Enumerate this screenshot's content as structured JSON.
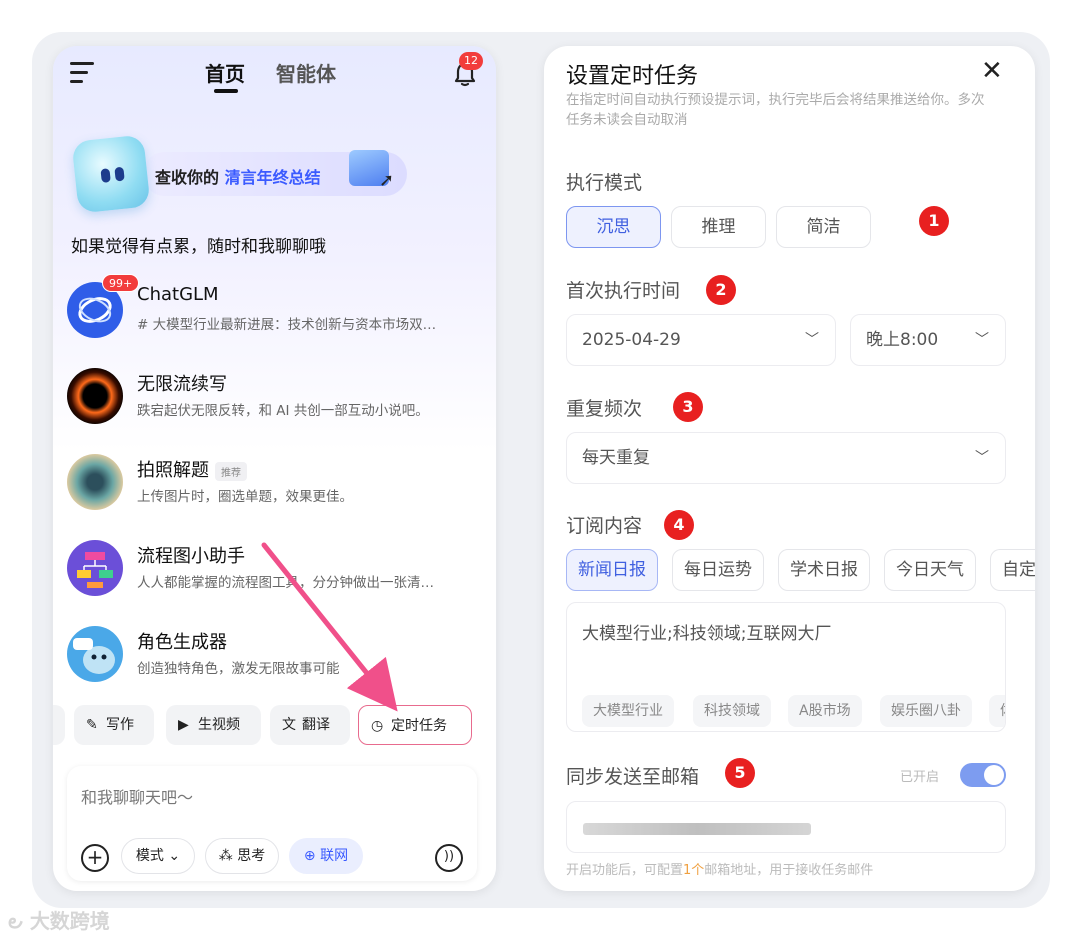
{
  "left_phone": {
    "tabs": [
      "首页",
      "智能体"
    ],
    "notification_count": "12",
    "banner": {
      "prefix": "查收你的 ",
      "highlight": "清言年终总结"
    },
    "greeting": "如果觉得有点累，随时和我聊聊哦",
    "agents": [
      {
        "name": "ChatGLM",
        "desc": "# 大模型行业最新进展：技术创新与资本市场双…",
        "badge": "99+"
      },
      {
        "name": "无限流续写",
        "desc": "跌宕起伏无限反转，和 AI 共创一部互动小说吧。"
      },
      {
        "name": "拍照解题",
        "desc": "上传图片时，圈选单题，效果更佳。",
        "tag": "推荐"
      },
      {
        "name": "流程图小助手",
        "desc": "人人都能掌握的流程图工具，分分钟做出一张清…"
      },
      {
        "name": "角色生成器",
        "desc": "创造独特角色，激发无限故事可能"
      }
    ],
    "quick_actions": [
      "写作",
      "生视频",
      "翻译",
      "定时任务"
    ],
    "input": {
      "placeholder": "和我聊聊天吧～",
      "mode_label": "模式",
      "think_label": "思考",
      "web_label": "联网"
    }
  },
  "right_phone": {
    "title": "设置定时任务",
    "subtitle": "在指定时间自动执行预设提示词，执行完毕后会将结果推送给你。多次任务未读会自动取消",
    "sections": {
      "mode": "执行模式",
      "first_time": "首次执行时间",
      "repeat": "重复频次",
      "subscription": "订阅内容",
      "email": "同步发送至邮箱"
    },
    "mode_options": [
      "沉思",
      "推理",
      "简洁"
    ],
    "date_value": "2025-04-29",
    "time_value": "晚上8:00",
    "repeat_value": "每天重复",
    "subscription_options": [
      "新闻日报",
      "每日运势",
      "学术日报",
      "今日天气",
      "自定"
    ],
    "keywords_text": "大模型行业;科技领域;互联网大厂",
    "keyword_chips": [
      "大模型行业",
      "科技领域",
      "A股市场",
      "娱乐圈八卦",
      "体"
    ],
    "toggle_status": "已开启",
    "footnote": {
      "pre": "开启功能后，可配置",
      "num": "1个",
      "post": "邮箱地址，用于接收任务邮件"
    }
  },
  "annotations": [
    "1",
    "2",
    "3",
    "4",
    "5"
  ],
  "watermark": "大数跨境",
  "colors": {
    "accent": "#4060e0",
    "annotation_red": "#e82020",
    "arrow": "#f0508a"
  }
}
